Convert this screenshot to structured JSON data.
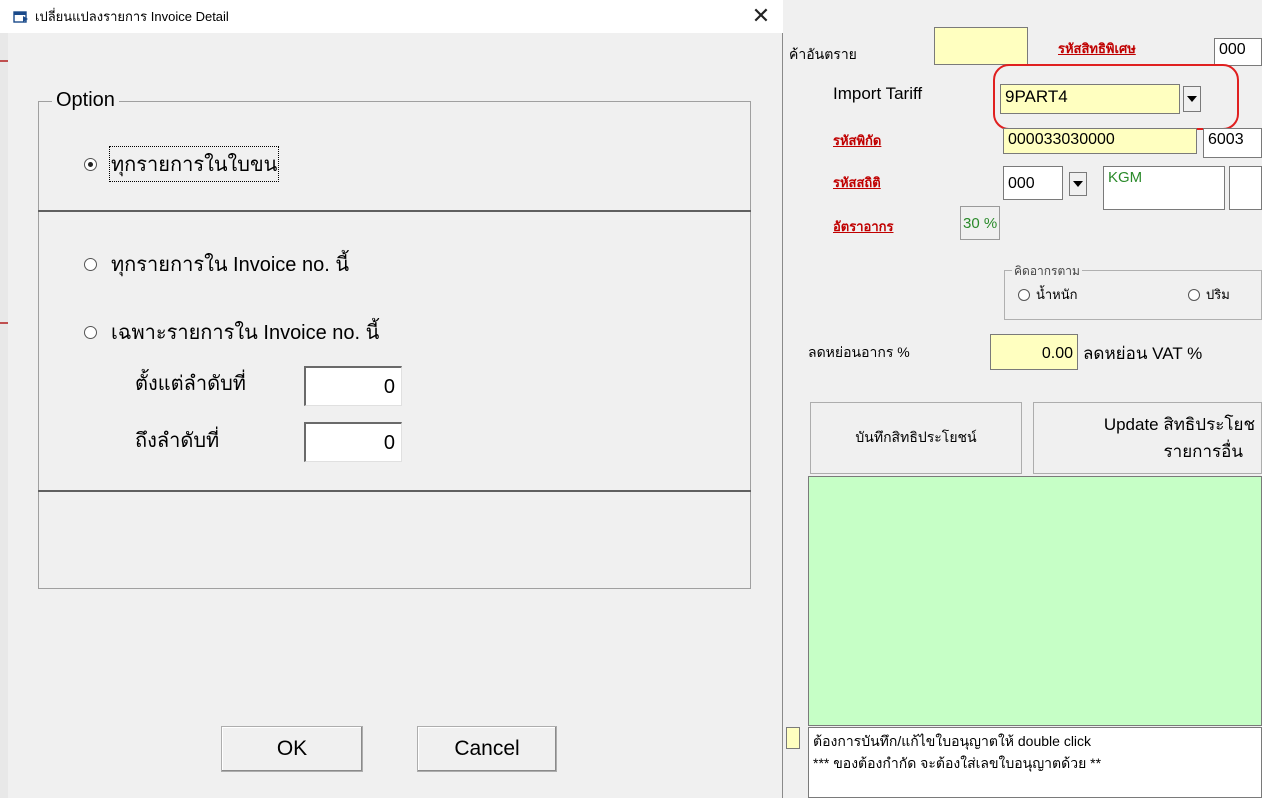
{
  "background": {
    "labels": {
      "dangerous_goods": "ค้าอันตราย",
      "privilege_code": "รหัสสิทธิพิเศษ",
      "privilege_value": "000",
      "import_tariff": "Import Tariff",
      "tariff_code_label": "รหัสพิกัด",
      "statistic_code_label": "รหัสสถิติ",
      "duty_rate_label": "อัตราอากร",
      "duty_by_group": "คิดอากรตาม",
      "by_weight": "น้ำหนัก",
      "by_quantity": "ปริม",
      "duty_reduction": "ลดหย่อนอากร %",
      "vat_reduction": "ลดหย่อน VAT %"
    },
    "fields": {
      "import_tariff_value": "9PART4",
      "tariff_code": "000033030000",
      "tariff_code_extra": "6003",
      "statistic_code": "000",
      "unit": "KGM",
      "duty_rate": "30 %",
      "duty_reduction_value": "0.00"
    },
    "buttons": {
      "save_privilege": "บันทึกสิทธิประโยชน์",
      "update_privilege_line1": "Update สิทธิประโยช",
      "update_privilege_line2": "รายการอื่น"
    },
    "status": {
      "line1": "ต้องการบันทึก/แก้ไขใบอนุญาตให้ double click",
      "line2": "*** ของต้องกำกัด จะต้องใส่เลขใบอนุญาตด้วย **"
    }
  },
  "dialog": {
    "title": "เปลี่ยนแปลงรายการ Invoice Detail",
    "close_symbol": "✕",
    "option_legend": "Option",
    "options": {
      "all_in_bl": "ทุกรายการในใบขน",
      "all_in_invoice": "ทุกรายการใน Invoice no. นี้",
      "only_in_invoice": "เฉพาะรายการใน Invoice no. นี้"
    },
    "selected_option": "all_in_bl",
    "range": {
      "from_label": "ตั้งแต่ลำดับที่",
      "from_value": "0",
      "to_label": "ถึงลำดับที่",
      "to_value": "0"
    },
    "ok_label": "OK",
    "cancel_label": "Cancel"
  },
  "colors": {
    "highlight_oval": "#e02020",
    "green_grid": "#c6ffc6",
    "yellow_field": "#ffffc0",
    "link_red": "#c00000"
  }
}
